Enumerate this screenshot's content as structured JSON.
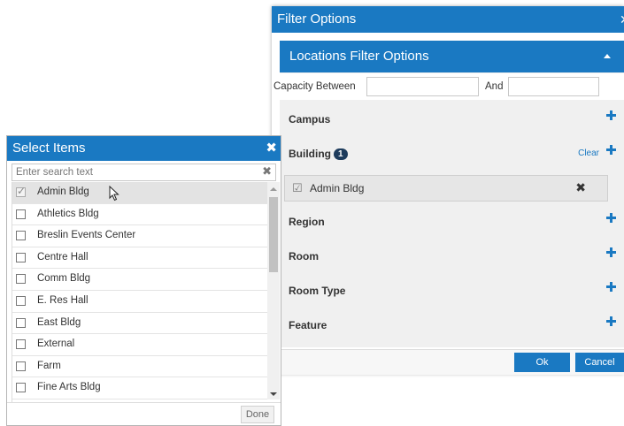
{
  "filter_dialog": {
    "title": "Filter Options",
    "close_glyph": "✕",
    "section_title": "Locations Filter Options",
    "capacity_label": "Capacity Between",
    "capacity_and_label": "And",
    "capacity_min_value": "",
    "capacity_max_value": "",
    "filters": [
      {
        "label": "Campus"
      },
      {
        "label": "Building",
        "badge": "1",
        "clear_label": "Clear"
      },
      {
        "label": "Region"
      },
      {
        "label": "Room"
      },
      {
        "label": "Room Type"
      },
      {
        "label": "Feature"
      }
    ],
    "selected_building": "Admin Bldg",
    "remove_glyph": "✖",
    "ok_label": "Ok",
    "cancel_label": "Cancel"
  },
  "select_dialog": {
    "title": "Select Items",
    "close_glyph": "✖",
    "search_placeholder": "Enter search text",
    "search_clear_glyph": "✖",
    "items": [
      {
        "label": "Admin Bldg",
        "checked": true
      },
      {
        "label": "Athletics Bldg",
        "checked": false
      },
      {
        "label": "Breslin Events Center",
        "checked": false
      },
      {
        "label": "Centre Hall",
        "checked": false
      },
      {
        "label": "Comm Bldg",
        "checked": false
      },
      {
        "label": "E. Res Hall",
        "checked": false
      },
      {
        "label": "East Bldg",
        "checked": false
      },
      {
        "label": "External",
        "checked": false
      },
      {
        "label": "Farm",
        "checked": false
      },
      {
        "label": "Fine Arts Bldg",
        "checked": false
      }
    ],
    "done_label": "Done"
  },
  "colors": {
    "accent": "#1a79c2",
    "badge": "#1d3b5c",
    "panel_bg": "#f0f0f0"
  }
}
